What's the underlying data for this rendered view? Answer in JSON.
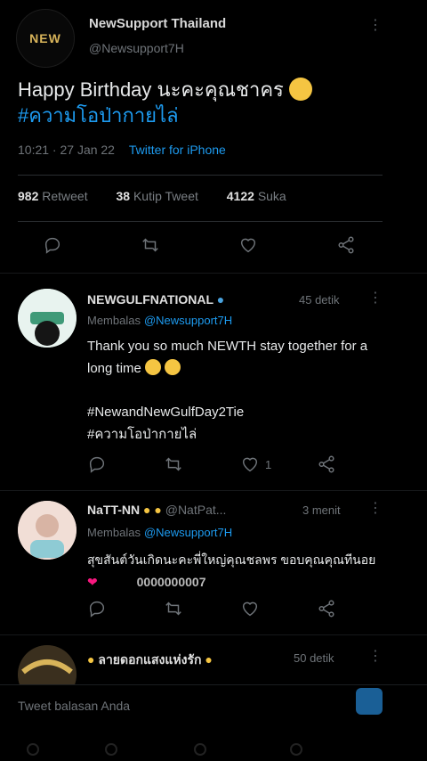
{
  "tweet": {
    "account_name": "NewSupport Thailand",
    "account_handle": "@Newsupport7H",
    "text": "Happy Birthday นะคะคุณชาคร",
    "hashtag": "#ความโอป่ากายไล่",
    "time": "10:21 · 27 Jan 22",
    "source": "Twitter for iPhone"
  },
  "stats": {
    "retweets_count": "982",
    "retweets_label": "Retweet",
    "quotes_count": "38",
    "quotes_label": "Kutip Tweet",
    "likes_count": "4122",
    "likes_label": "Suka"
  },
  "replies": [
    {
      "name": "NEWGULFNATIONAL",
      "time": "45 detik",
      "replying_label": "Membalas",
      "replying_to": "@Newsupport7H",
      "text": "Thank you so much NEWTH stay together for a long time",
      "hashtags": [
        "#NewandNewGulfDay2Tie",
        "#ความโอป่ากายไล่"
      ],
      "reply_count": "",
      "like_count": "1"
    },
    {
      "name": "NaTT-NN",
      "handle": "@NatPat...",
      "time": "3 menit",
      "replying_label": "Membalas",
      "replying_to": "@Newsupport7H",
      "text": "สุขสันต์วันเกิดนะคะพี่ใหญ่คุณชลพร ขอบคุณคุณทีนอย",
      "overlay_text": "0000000007"
    },
    {
      "name": "ลายดอกแสงแห่งรัก",
      "time": "50 detik"
    }
  ],
  "composer": {
    "placeholder": "Tweet balasan Anda"
  },
  "colors": {
    "background": "#000000",
    "accent": "#1d9bf0",
    "muted": "#6f7479",
    "heart": "#f91880"
  }
}
